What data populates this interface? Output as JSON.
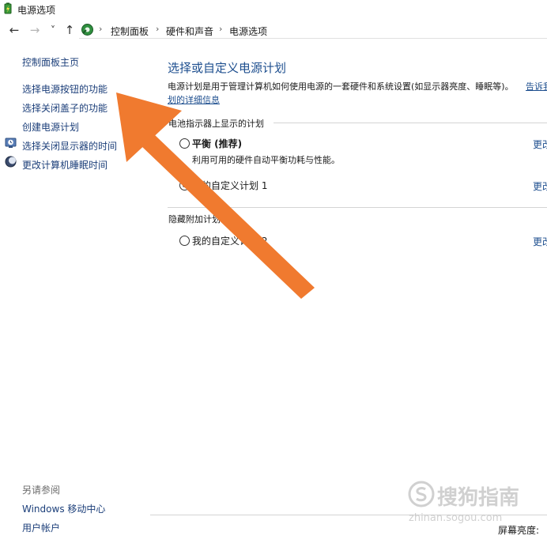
{
  "window": {
    "title": "电源选项",
    "app_icon": "power-options-icon"
  },
  "nav": {
    "back": "←",
    "forward": "→",
    "recent": "˅",
    "up": "↑",
    "separator": "›",
    "breadcrumbs": [
      "控制面板",
      "硬件和声音",
      "电源选项"
    ]
  },
  "sidebar": {
    "home": "控制面板主页",
    "items": [
      {
        "label": "选择电源按钮的功能",
        "icon": null
      },
      {
        "label": "选择关闭盖子的功能",
        "icon": null
      },
      {
        "label": "创建电源计划",
        "icon": null
      },
      {
        "label": "选择关闭显示器的时间",
        "icon": "display-timer-icon"
      },
      {
        "label": "更改计算机睡眠时间",
        "icon": "sleep-moon-icon"
      }
    ],
    "see_also_title": "另请参阅",
    "see_also": [
      "Windows 移动中心",
      "用户帐户"
    ]
  },
  "main": {
    "heading": "选择或自定义电源计划",
    "description": "电源计划是用于管理计算机如何使用电源的一套硬件和系统设置(如显示器亮度、睡眠等)。",
    "desc_link_1": "告诉我",
    "desc_link_2": "划的详细信息",
    "group1": {
      "title": "电池指示器上显示的计划",
      "plans": [
        {
          "name": "平衡 (推荐)",
          "desc": "利用可用的硬件自动平衡功耗与性能。",
          "selected": false,
          "change": "更改"
        },
        {
          "name": "我的自定义计划 1",
          "desc": "",
          "selected": true,
          "change": "更改"
        }
      ]
    },
    "group2": {
      "title": "隐藏附加计划",
      "plans": [
        {
          "name": "我的自定义计划 2",
          "desc": "",
          "selected": false,
          "change": "更改"
        }
      ]
    },
    "brightness_label": "屏幕亮度:"
  },
  "overlay": {
    "arrow_color": "#f07a2f",
    "watermark_text": "搜狗指南",
    "watermark_url": "zhinan.sogou.com"
  }
}
